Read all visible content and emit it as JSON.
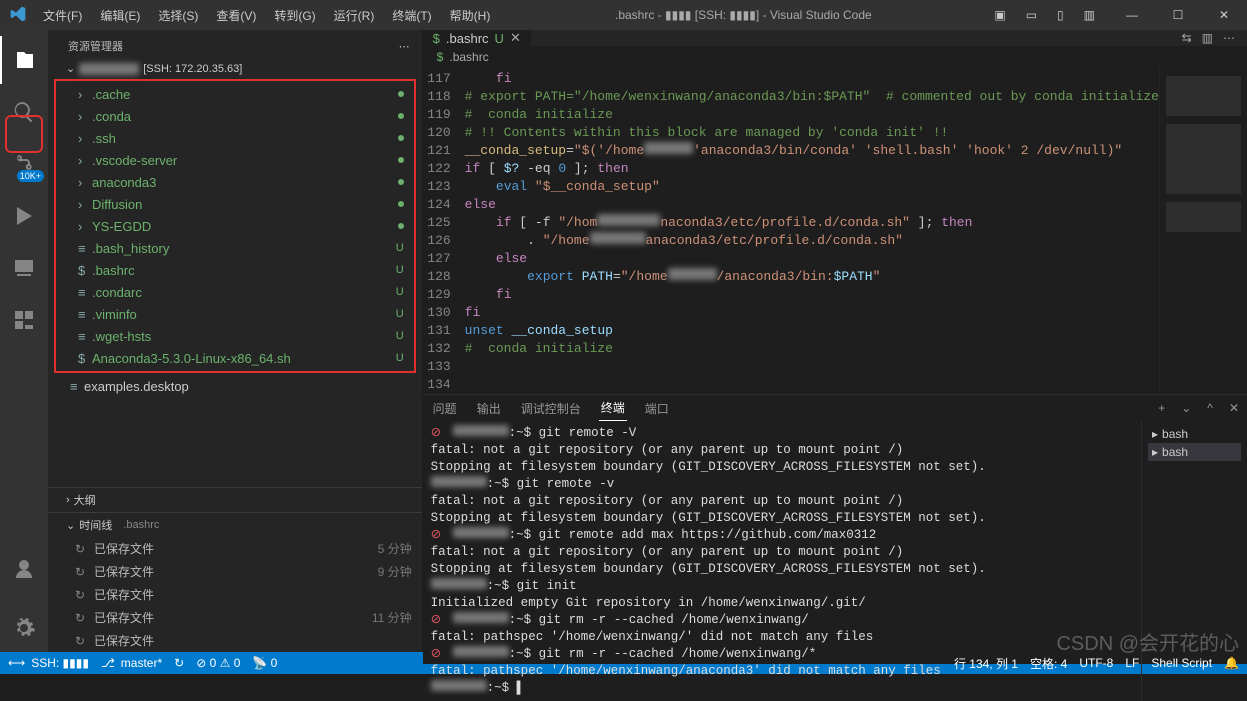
{
  "titlebar": {
    "menus": [
      "文件(F)",
      "编辑(E)",
      "选择(S)",
      "查看(V)",
      "转到(G)",
      "运行(R)",
      "终端(T)",
      "帮助(H)"
    ],
    "title": ".bashrc - ▮▮▮▮ [SSH: ▮▮▮▮] - Visual Studio Code"
  },
  "activity": {
    "badge": "10K+"
  },
  "sidebar": {
    "title": "资源管理器",
    "hostLabel": "[SSH: 172.20.35.63]",
    "tree": [
      {
        "type": "dir",
        "name": ".cache",
        "status": "dot"
      },
      {
        "type": "dir",
        "name": ".conda",
        "status": "dot"
      },
      {
        "type": "dir",
        "name": ".ssh",
        "status": "dot"
      },
      {
        "type": "dir",
        "name": ".vscode-server",
        "status": "dot"
      },
      {
        "type": "dir",
        "name": "anaconda3",
        "status": "dot"
      },
      {
        "type": "dir",
        "name": "Diffusion",
        "status": "dot"
      },
      {
        "type": "dir",
        "name": "YS-EGDD",
        "status": "dot"
      },
      {
        "type": "file",
        "icon": "≡",
        "name": ".bash_history",
        "status": "U"
      },
      {
        "type": "file",
        "icon": "$",
        "name": ".bashrc",
        "status": "U"
      },
      {
        "type": "file",
        "icon": "≡",
        "name": ".condarc",
        "status": "U"
      },
      {
        "type": "file",
        "icon": "≡",
        "name": ".viminfo",
        "status": "U"
      },
      {
        "type": "file",
        "icon": "≡",
        "name": ".wget-hsts",
        "status": "U"
      },
      {
        "type": "file",
        "icon": "$",
        "name": "Anaconda3-5.3.0-Linux-x86_64.sh",
        "status": "U"
      }
    ],
    "outside": {
      "icon": "≡",
      "name": "examples.desktop"
    },
    "outline": "大纲",
    "timelineTitle": "时间线",
    "timelineFile": ".bashrc",
    "timeline": [
      {
        "name": "已保存文件",
        "time": "5 分钟"
      },
      {
        "name": "已保存文件",
        "time": "9 分钟"
      },
      {
        "name": "已保存文件",
        "time": ""
      },
      {
        "name": "已保存文件",
        "time": "11 分钟"
      },
      {
        "name": "已保存文件",
        "time": ""
      }
    ]
  },
  "editor": {
    "tabIcon": "$",
    "tabName": ".bashrc",
    "tabMod": "U",
    "breadcrumbIcon": "$",
    "breadcrumb": ".bashrc",
    "code": {
      "start": 117,
      "raw": [
        "    <kw>fi</kw>",
        "<cmt># export PATH=\"/home/wenxinwang/anaconda3/bin:$PATH\"  # commented out by conda initialize</cmt>",
        "<cmt># >>> conda initialize >>></cmt>",
        "<cmt># !! Contents within this block are managed by 'conda init' !!</cmt>",
        "<def>__conda_setup</def>=<str>\"$('/home▮▮▮▮▮▮▮'anaconda3/bin/conda' 'shell.bash' 'hook' 2> /dev/null)\"</str>",
        "<kw>if</kw> [ <var>$?</var> -eq <fn>0</fn> ]; <kw>then</kw>",
        "    <fn>eval</fn> <str>\"$__conda_setup\"</str>",
        "<kw>else</kw>",
        "    <kw>if</kw> [ -f <str>\"/hom▮▮▮▮▮▮▮▮▮naconda3/etc/profile.d/conda.sh\"</str> ]; <kw>then</kw>",
        "        . <str>\"/home▮▮▮▮▮▮▮▮anaconda3/etc/profile.d/conda.sh\"</str>",
        "    <kw>else</kw>",
        "        <fn>export</fn> <var>PATH</var>=<str>\"/home▮▮▮▮▮▮▮/anaconda3/bin:</str><var>$PATH</var><str>\"</str>",
        "    <kw>fi</kw>",
        "<kw>fi</kw>",
        "<fn>unset</fn> <var>__conda_setup</var>",
        "<cmt># <<< conda initialize <<<</cmt>",
        "",
        ""
      ]
    }
  },
  "panel": {
    "tabs": [
      "问题",
      "输出",
      "调试控制台",
      "终端",
      "端口"
    ],
    "activeTab": 3,
    "sideItems": [
      "bash",
      "bash"
    ],
    "terminal": [
      "<e>⊘</e> <b>▮▮▮▮▮▮▮▮</b>:~$ git remote -V",
      "fatal: not a git repository (or any parent up to mount point /)",
      "Stopping at filesystem boundary (GIT_DISCOVERY_ACROSS_FILESYSTEM not set).",
      "<b>▮▮▮▮▮▮▮▮</b>:~$ git remote -v",
      "fatal: not a git repository (or any parent up to mount point /)",
      "Stopping at filesystem boundary (GIT_DISCOVERY_ACROSS_FILESYSTEM not set).",
      "<e>⊘</e> <b>▮▮▮▮▮▮▮▮</b>:~$ git remote add max https://github.com/max0312",
      "fatal: not a git repository (or any parent up to mount point /)",
      "Stopping at filesystem boundary (GIT_DISCOVERY_ACROSS_FILESYSTEM not set).",
      "<b>▮▮▮▮▮▮▮▮</b>:~$ git init",
      "Initialized empty Git repository in /home/wenxinwang/.git/",
      "<e>⊘</e> <b>▮▮▮▮▮▮▮▮</b>:~$ git rm -r --cached /home/wenxinwang/",
      "fatal: pathspec '/home/wenxinwang/' did not match any files",
      "<e>⊘</e> <b>▮▮▮▮▮▮▮▮</b>:~$ git rm -r --cached /home/wenxinwang/*",
      "fatal: pathspec '/home/wenxinwang/anaconda3' did not match any files",
      "<b>▮▮▮▮▮▮▮▮</b>:~$ ▌"
    ]
  },
  "status": {
    "remote": "SSH: ▮▮▮▮",
    "branch": "master*",
    "sync": "↻",
    "problems": "⊘ 0 ⚠ 0",
    "ports": "📡 0",
    "lncol": "行 134, 列 1",
    "spaces": "空格: 4",
    "enc": "UTF-8",
    "eol": "LF",
    "lang": "Shell Script",
    "bell": "🔔"
  },
  "watermark": "CSDN @会开花的心"
}
